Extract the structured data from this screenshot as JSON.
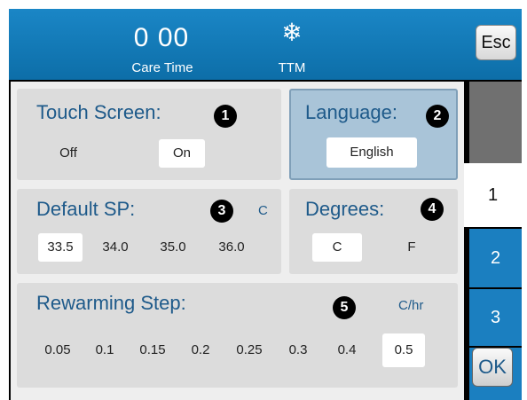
{
  "header": {
    "time": "0 00",
    "time_label": "Care Time",
    "mode_icon": "snowflake-icon",
    "mode_label": "TTM",
    "esc_label": "Esc"
  },
  "touch_screen": {
    "title": "Touch Screen:",
    "badge": "1",
    "options": [
      "Off",
      "On"
    ],
    "selected": "On"
  },
  "language": {
    "title": "Language:",
    "badge": "2",
    "value": "English"
  },
  "default_sp": {
    "title": "Default SP:",
    "badge": "3",
    "unit": "C",
    "options": [
      "33.5",
      "34.0",
      "35.0",
      "36.0"
    ],
    "selected": "33.5"
  },
  "degrees": {
    "title": "Degrees:",
    "badge": "4",
    "options": [
      "C",
      "F"
    ],
    "selected": "C"
  },
  "rewarming": {
    "title": "Rewarming Step:",
    "badge": "5",
    "unit": "C/hr",
    "options": [
      "0.05",
      "0.1",
      "0.15",
      "0.2",
      "0.25",
      "0.3",
      "0.4",
      "0.5"
    ],
    "selected": "0.5"
  },
  "tabs": [
    {
      "label": "1",
      "active": true
    },
    {
      "label": "2",
      "active": false
    },
    {
      "label": "3",
      "active": false
    }
  ],
  "ok_label": "OK",
  "colors": {
    "header_blue": "#1a86c6",
    "title_blue": "#1e5a8a",
    "tab_blue": "#1b7fc0",
    "panel_gray": "#dcdcdc",
    "language_panel": "#a9c4d8"
  }
}
